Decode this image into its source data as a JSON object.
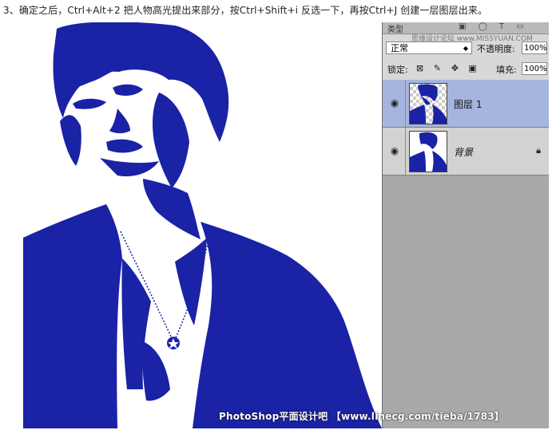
{
  "caption": "3、确定之后，Ctrl+Alt+2 把人物高光提出来部分，按Ctrl+Shift+i 反选一下，再按Ctrl+J 创建一层图层出来。",
  "colors": {
    "accent": "#1a22a6",
    "selected_layer": "#a6b5dd",
    "panel_bg": "#aaa9a9"
  },
  "layers_panel": {
    "tab_label": "类型",
    "watermark_top": "思缘设计论坛 www.MISSYUAN.COM",
    "blend_mode": "正常",
    "opacity_label": "不透明度:",
    "opacity_value": "100%",
    "lock_label": "锁定:",
    "lock_icons": [
      "checkerboard-lock-icon",
      "brush-lock-icon",
      "move-lock-icon",
      "padlock-icon"
    ],
    "fill_label": "填充:",
    "fill_value": "100%",
    "layers": [
      {
        "name": "图层 1",
        "selected": true,
        "locked": false
      },
      {
        "name": "背景",
        "selected": false,
        "locked": true
      }
    ]
  },
  "footer_watermark": "PhotoShop平面设计吧 【www.linecg.com/tieba/1783】"
}
